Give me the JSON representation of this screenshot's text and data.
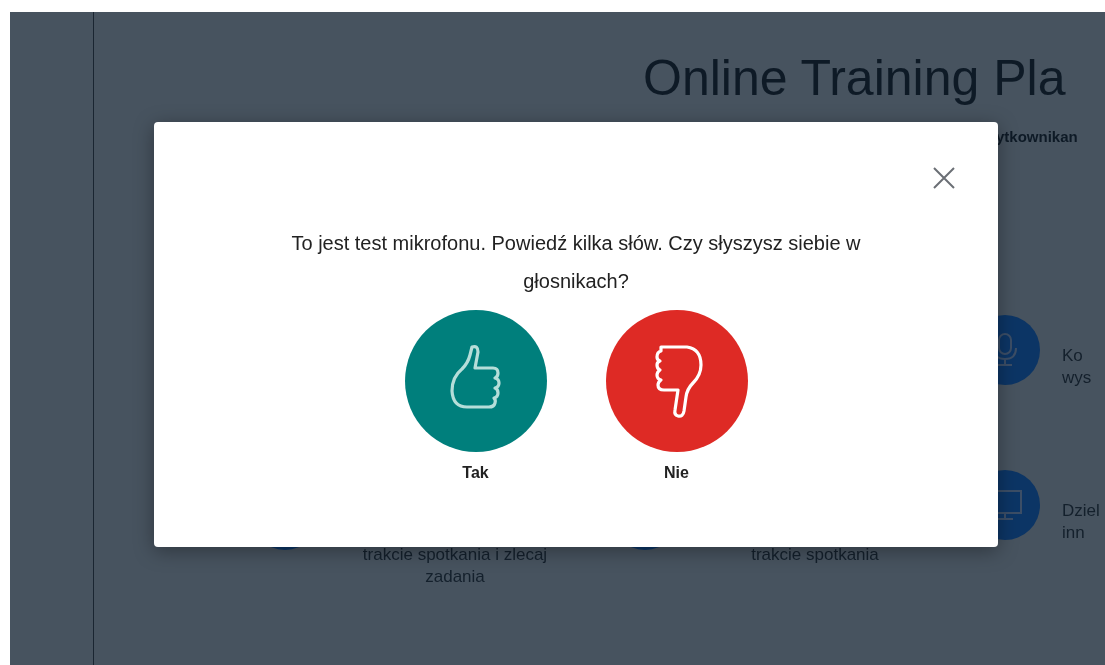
{
  "page": {
    "title": "Online Training Pla",
    "subtitle": "ytkownikan",
    "features": [
      {
        "kind": "microphone",
        "text": "Ko\nwys"
      },
      {
        "kind": "plain",
        "text": "trakcie spotkania i zlecaj\nzadania"
      },
      {
        "kind": "plain",
        "text": "trakcie spotkania"
      },
      {
        "kind": "monitor",
        "text": "Dziel\ninn"
      }
    ]
  },
  "dialog": {
    "question": "To jest test mikrofonu. Powiedź kilka słów. Czy słyszysz siebie w głosnikach?",
    "answers": [
      {
        "kind": "yes",
        "label": "Tak"
      },
      {
        "kind": "no",
        "label": "Nie"
      }
    ]
  }
}
